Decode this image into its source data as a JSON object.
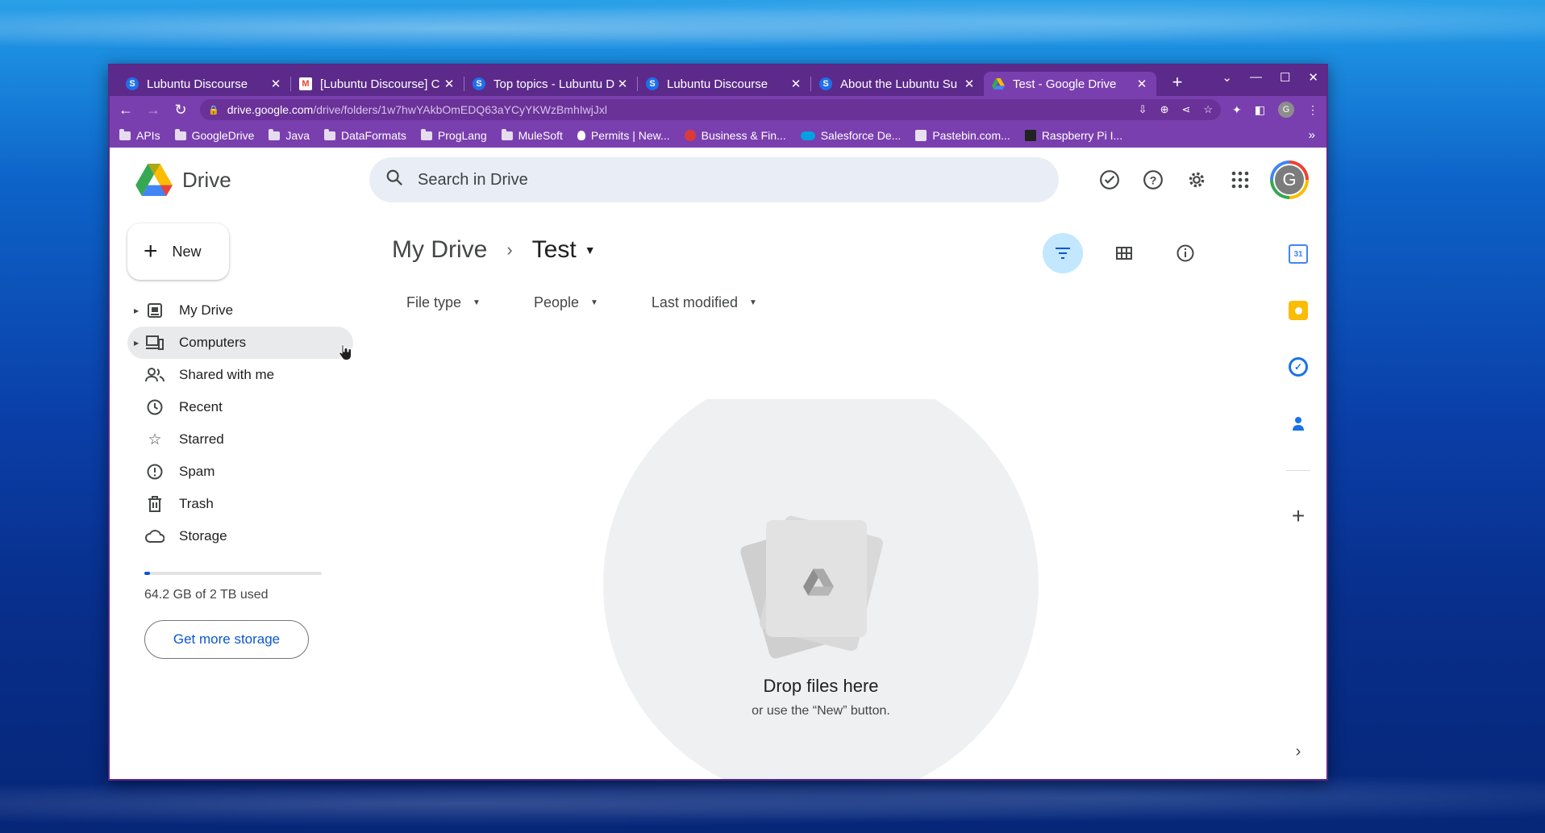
{
  "browser": {
    "tabs": [
      {
        "title": "Lubuntu Discourse",
        "icon": "discourse-icon"
      },
      {
        "title": "[Lubuntu Discourse] C",
        "icon": "gmail-icon"
      },
      {
        "title": "Top topics - Lubuntu D",
        "icon": "discourse-icon"
      },
      {
        "title": "Lubuntu Discourse",
        "icon": "discourse-icon"
      },
      {
        "title": "About the Lubuntu Su",
        "icon": "discourse-icon"
      },
      {
        "title": "Test - Google Drive",
        "icon": "drive-icon",
        "active": true
      }
    ],
    "url_host": "drive.google.com",
    "url_path": "/drive/folders/1w7hwYAkbOmEDQ63aYCyYKWzBmhIwjJxl",
    "profile_initial": "G",
    "bookmarks": [
      {
        "label": "APIs",
        "icon": "folder-icon"
      },
      {
        "label": "GoogleDrive",
        "icon": "folder-icon"
      },
      {
        "label": "Java",
        "icon": "folder-icon"
      },
      {
        "label": "DataFormats",
        "icon": "folder-icon"
      },
      {
        "label": "ProgLang",
        "icon": "folder-icon"
      },
      {
        "label": "MuleSoft",
        "icon": "folder-icon"
      },
      {
        "label": "Permits | New...",
        "icon": "permits-icon"
      },
      {
        "label": "Business & Fin...",
        "icon": "business-icon"
      },
      {
        "label": "Salesforce De...",
        "icon": "salesforce-icon"
      },
      {
        "label": "Pastebin.com...",
        "icon": "pastebin-icon"
      },
      {
        "label": "Raspberry Pi I...",
        "icon": "raspberry-icon"
      }
    ],
    "overflow": "»"
  },
  "drive": {
    "app_name": "Drive",
    "search_placeholder": "Search in Drive",
    "avatar_initial": "G",
    "new_label": "New",
    "nav": [
      {
        "label": "My Drive",
        "icon": "my-drive-icon",
        "caret": true
      },
      {
        "label": "Computers",
        "icon": "computers-icon",
        "caret": true,
        "hover": true
      },
      {
        "label": "Shared with me",
        "icon": "shared-icon"
      },
      {
        "label": "Recent",
        "icon": "clock-icon"
      },
      {
        "label": "Starred",
        "icon": "star-icon"
      },
      {
        "label": "Spam",
        "icon": "spam-icon"
      },
      {
        "label": "Trash",
        "icon": "trash-icon"
      },
      {
        "label": "Storage",
        "icon": "cloud-icon"
      }
    ],
    "storage_used_fraction": 0.03,
    "storage_text": "64.2 GB of 2 TB used",
    "get_storage_label": "Get more storage",
    "breadcrumb_root": "My Drive",
    "breadcrumb_current": "Test",
    "filters": [
      "File type",
      "People",
      "Last modified"
    ],
    "empty_title": "Drop files here",
    "empty_subtitle": "or use the “New” button.",
    "calendar_day": "31",
    "colors": {
      "accent": "#0b57d0",
      "active_view": "#c2e7ff",
      "chrome": "#7a3fae"
    }
  }
}
